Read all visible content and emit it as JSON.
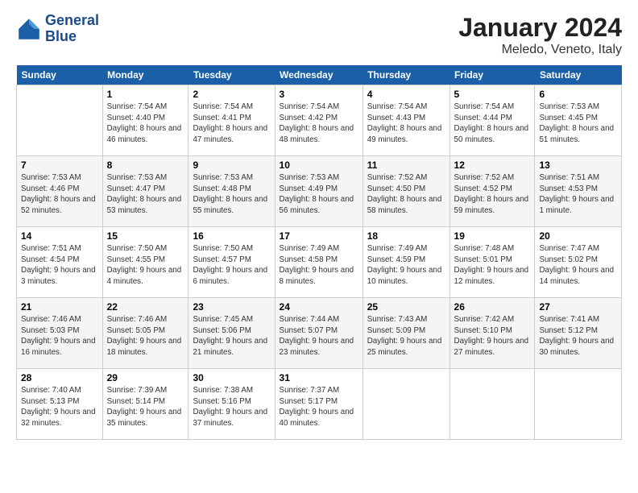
{
  "header": {
    "logo_line1": "General",
    "logo_line2": "Blue",
    "month": "January 2024",
    "location": "Meledo, Veneto, Italy"
  },
  "weekdays": [
    "Sunday",
    "Monday",
    "Tuesday",
    "Wednesday",
    "Thursday",
    "Friday",
    "Saturday"
  ],
  "weeks": [
    [
      {
        "day": "",
        "sunrise": "",
        "sunset": "",
        "daylight": ""
      },
      {
        "day": "1",
        "sunrise": "7:54 AM",
        "sunset": "4:40 PM",
        "daylight": "8 hours and 46 minutes."
      },
      {
        "day": "2",
        "sunrise": "7:54 AM",
        "sunset": "4:41 PM",
        "daylight": "8 hours and 47 minutes."
      },
      {
        "day": "3",
        "sunrise": "7:54 AM",
        "sunset": "4:42 PM",
        "daylight": "8 hours and 48 minutes."
      },
      {
        "day": "4",
        "sunrise": "7:54 AM",
        "sunset": "4:43 PM",
        "daylight": "8 hours and 49 minutes."
      },
      {
        "day": "5",
        "sunrise": "7:54 AM",
        "sunset": "4:44 PM",
        "daylight": "8 hours and 50 minutes."
      },
      {
        "day": "6",
        "sunrise": "7:53 AM",
        "sunset": "4:45 PM",
        "daylight": "8 hours and 51 minutes."
      }
    ],
    [
      {
        "day": "7",
        "sunrise": "7:53 AM",
        "sunset": "4:46 PM",
        "daylight": "8 hours and 52 minutes."
      },
      {
        "day": "8",
        "sunrise": "7:53 AM",
        "sunset": "4:47 PM",
        "daylight": "8 hours and 53 minutes."
      },
      {
        "day": "9",
        "sunrise": "7:53 AM",
        "sunset": "4:48 PM",
        "daylight": "8 hours and 55 minutes."
      },
      {
        "day": "10",
        "sunrise": "7:53 AM",
        "sunset": "4:49 PM",
        "daylight": "8 hours and 56 minutes."
      },
      {
        "day": "11",
        "sunrise": "7:52 AM",
        "sunset": "4:50 PM",
        "daylight": "8 hours and 58 minutes."
      },
      {
        "day": "12",
        "sunrise": "7:52 AM",
        "sunset": "4:52 PM",
        "daylight": "8 hours and 59 minutes."
      },
      {
        "day": "13",
        "sunrise": "7:51 AM",
        "sunset": "4:53 PM",
        "daylight": "9 hours and 1 minute."
      }
    ],
    [
      {
        "day": "14",
        "sunrise": "7:51 AM",
        "sunset": "4:54 PM",
        "daylight": "9 hours and 3 minutes."
      },
      {
        "day": "15",
        "sunrise": "7:50 AM",
        "sunset": "4:55 PM",
        "daylight": "9 hours and 4 minutes."
      },
      {
        "day": "16",
        "sunrise": "7:50 AM",
        "sunset": "4:57 PM",
        "daylight": "9 hours and 6 minutes."
      },
      {
        "day": "17",
        "sunrise": "7:49 AM",
        "sunset": "4:58 PM",
        "daylight": "9 hours and 8 minutes."
      },
      {
        "day": "18",
        "sunrise": "7:49 AM",
        "sunset": "4:59 PM",
        "daylight": "9 hours and 10 minutes."
      },
      {
        "day": "19",
        "sunrise": "7:48 AM",
        "sunset": "5:01 PM",
        "daylight": "9 hours and 12 minutes."
      },
      {
        "day": "20",
        "sunrise": "7:47 AM",
        "sunset": "5:02 PM",
        "daylight": "9 hours and 14 minutes."
      }
    ],
    [
      {
        "day": "21",
        "sunrise": "7:46 AM",
        "sunset": "5:03 PM",
        "daylight": "9 hours and 16 minutes."
      },
      {
        "day": "22",
        "sunrise": "7:46 AM",
        "sunset": "5:05 PM",
        "daylight": "9 hours and 18 minutes."
      },
      {
        "day": "23",
        "sunrise": "7:45 AM",
        "sunset": "5:06 PM",
        "daylight": "9 hours and 21 minutes."
      },
      {
        "day": "24",
        "sunrise": "7:44 AM",
        "sunset": "5:07 PM",
        "daylight": "9 hours and 23 minutes."
      },
      {
        "day": "25",
        "sunrise": "7:43 AM",
        "sunset": "5:09 PM",
        "daylight": "9 hours and 25 minutes."
      },
      {
        "day": "26",
        "sunrise": "7:42 AM",
        "sunset": "5:10 PM",
        "daylight": "9 hours and 27 minutes."
      },
      {
        "day": "27",
        "sunrise": "7:41 AM",
        "sunset": "5:12 PM",
        "daylight": "9 hours and 30 minutes."
      }
    ],
    [
      {
        "day": "28",
        "sunrise": "7:40 AM",
        "sunset": "5:13 PM",
        "daylight": "9 hours and 32 minutes."
      },
      {
        "day": "29",
        "sunrise": "7:39 AM",
        "sunset": "5:14 PM",
        "daylight": "9 hours and 35 minutes."
      },
      {
        "day": "30",
        "sunrise": "7:38 AM",
        "sunset": "5:16 PM",
        "daylight": "9 hours and 37 minutes."
      },
      {
        "day": "31",
        "sunrise": "7:37 AM",
        "sunset": "5:17 PM",
        "daylight": "9 hours and 40 minutes."
      },
      {
        "day": "",
        "sunrise": "",
        "sunset": "",
        "daylight": ""
      },
      {
        "day": "",
        "sunrise": "",
        "sunset": "",
        "daylight": ""
      },
      {
        "day": "",
        "sunrise": "",
        "sunset": "",
        "daylight": ""
      }
    ]
  ],
  "labels": {
    "sunrise_prefix": "Sunrise: ",
    "sunset_prefix": "Sunset: ",
    "daylight_prefix": "Daylight: "
  }
}
